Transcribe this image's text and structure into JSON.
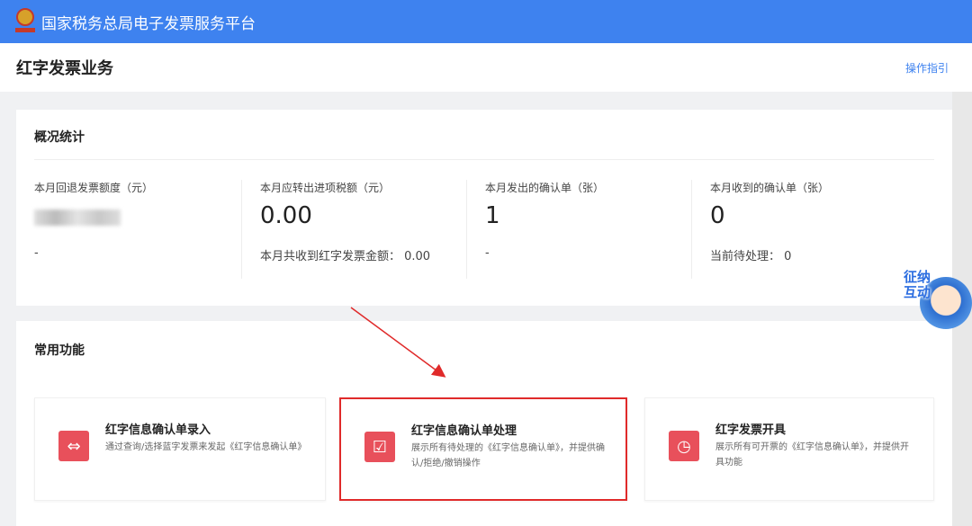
{
  "header": {
    "title": "国家税务总局电子发票服务平台"
  },
  "page": {
    "title": "红字发票业务",
    "guide_link": "操作指引"
  },
  "stats": {
    "title": "概况统计",
    "items": [
      {
        "label": "本月回退发票额度（元）",
        "value": "",
        "footer": "-"
      },
      {
        "label": "本月应转出进项税额（元）",
        "value": "0.00",
        "footer": "本月共收到红字发票金额： 0.00"
      },
      {
        "label": "本月发出的确认单（张）",
        "value": "1",
        "footer": "-"
      },
      {
        "label": "本月收到的确认单（张）",
        "value": "0",
        "footer": "当前待处理： 0"
      }
    ]
  },
  "functions": {
    "title": "常用功能",
    "items": [
      {
        "title": "红字信息确认单录入",
        "desc": "通过查询/选择蓝字发票来发起《红字信息确认单》",
        "icon": "entry-icon"
      },
      {
        "title": "红字信息确认单处理",
        "desc": "展示所有待处理的《红字信息确认单》，并提供确认/拒绝/撤销操作",
        "icon": "process-icon"
      },
      {
        "title": "红字发票开具",
        "desc": "展示所有可开票的《红字信息确认单》，并提供开具功能",
        "icon": "issue-icon"
      }
    ]
  },
  "mascot": {
    "text": "征纳互动"
  },
  "colors": {
    "header": "#3e82ef",
    "icon": "#e8505b",
    "highlight": "#e02a2a"
  }
}
